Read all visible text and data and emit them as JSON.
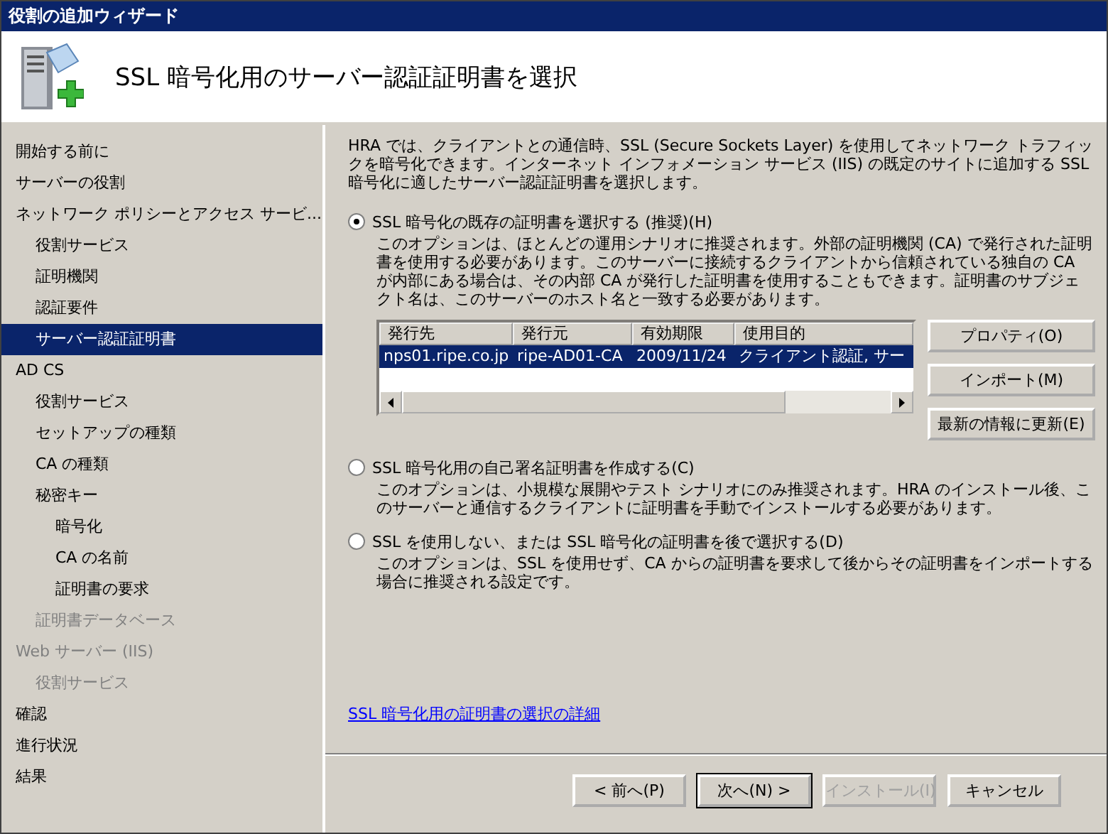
{
  "window": {
    "title": "役割の追加ウィザード"
  },
  "header": {
    "heading": "SSL 暗号化用のサーバー認証証明書を選択"
  },
  "sidebar": {
    "items": [
      {
        "label": "開始する前に",
        "selected": false,
        "disabled": false
      },
      {
        "label": "サーバーの役割",
        "selected": false,
        "disabled": false
      },
      {
        "label": "ネットワーク ポリシーとアクセス サービ...",
        "selected": false,
        "disabled": false,
        "children": [
          {
            "label": "役割サービス",
            "selected": false,
            "disabled": false
          },
          {
            "label": "証明機関",
            "selected": false,
            "disabled": false
          },
          {
            "label": "認証要件",
            "selected": false,
            "disabled": false
          },
          {
            "label": "サーバー認証証明書",
            "selected": true,
            "disabled": false
          }
        ]
      },
      {
        "label": "AD CS",
        "selected": false,
        "disabled": false,
        "children": [
          {
            "label": "役割サービス",
            "selected": false,
            "disabled": false
          },
          {
            "label": "セットアップの種類",
            "selected": false,
            "disabled": false
          },
          {
            "label": "CA の種類",
            "selected": false,
            "disabled": false
          },
          {
            "label": "秘密キー",
            "selected": false,
            "disabled": false,
            "children": [
              {
                "label": "暗号化",
                "selected": false,
                "disabled": false
              },
              {
                "label": "CA の名前",
                "selected": false,
                "disabled": false
              },
              {
                "label": "証明書の要求",
                "selected": false,
                "disabled": false
              }
            ]
          },
          {
            "label": "証明書データベース",
            "selected": false,
            "disabled": true
          }
        ]
      },
      {
        "label": "Web サーバー (IIS)",
        "selected": false,
        "disabled": true,
        "children": [
          {
            "label": "役割サービス",
            "selected": false,
            "disabled": true
          }
        ]
      },
      {
        "label": "確認",
        "selected": false,
        "disabled": false
      },
      {
        "label": "進行状況",
        "selected": false,
        "disabled": false
      },
      {
        "label": "結果",
        "selected": false,
        "disabled": false
      }
    ]
  },
  "intro": "HRA では、クライアントとの通信時、SSL (Secure Sockets Layer) を使用してネットワーク トラフィックを暗号化できます。インターネット インフォメーション サービス (IIS) の既定のサイトに追加する SSL 暗号化に適したサーバー認証証明書を選択します。",
  "options": [
    {
      "label": "SSL 暗号化の既存の証明書を選択する (推奨)(H)",
      "selected": true,
      "description": "このオプションは、ほとんどの運用シナリオに推奨されます。外部の証明機関 (CA) で発行された証明書を使用する必要があります。このサーバーに接続するクライアントから信頼されている独自の CA が内部にある場合は、その内部 CA が発行した証明書を使用することもできます。証明書のサブジェクト名は、このサーバーのホスト名と一致する必要があります。",
      "table": {
        "columns": [
          "発行先",
          "発行元",
          "有効期限",
          "使用目的"
        ],
        "rows": [
          {
            "cells": [
              "nps01.ripe.co.jp",
              "ripe-AD01-CA",
              "2009/11/24",
              "クライアント認証, サー"
            ],
            "selected": true
          }
        ]
      },
      "buttons": [
        {
          "label": "プロパティ(O)"
        },
        {
          "label": "インポート(M)"
        },
        {
          "label": "最新の情報に更新(E)"
        }
      ]
    },
    {
      "label": "SSL 暗号化用の自己署名証明書を作成する(C)",
      "selected": false,
      "description": "このオプションは、小規模な展開やテスト シナリオにのみ推奨されます。HRA のインストール後、このサーバーと通信するクライアントに証明書を手動でインストールする必要があります。"
    },
    {
      "label": "SSL を使用しない、または SSL 暗号化の証明書を後で選択する(D)",
      "selected": false,
      "description": "このオプションは、SSL を使用せず、CA からの証明書を要求して後からその証明書をインポートする場合に推奨される設定です。"
    }
  ],
  "link": "SSL 暗号化用の証明書の選択の詳細",
  "footer": {
    "buttons": [
      {
        "label": "< 前へ(P)",
        "disabled": false,
        "default": false
      },
      {
        "label": "次へ(N) >",
        "disabled": false,
        "default": true
      },
      {
        "label": "インストール(I)",
        "disabled": true,
        "default": false
      },
      {
        "label": "キャンセル",
        "disabled": false,
        "default": false
      }
    ]
  }
}
